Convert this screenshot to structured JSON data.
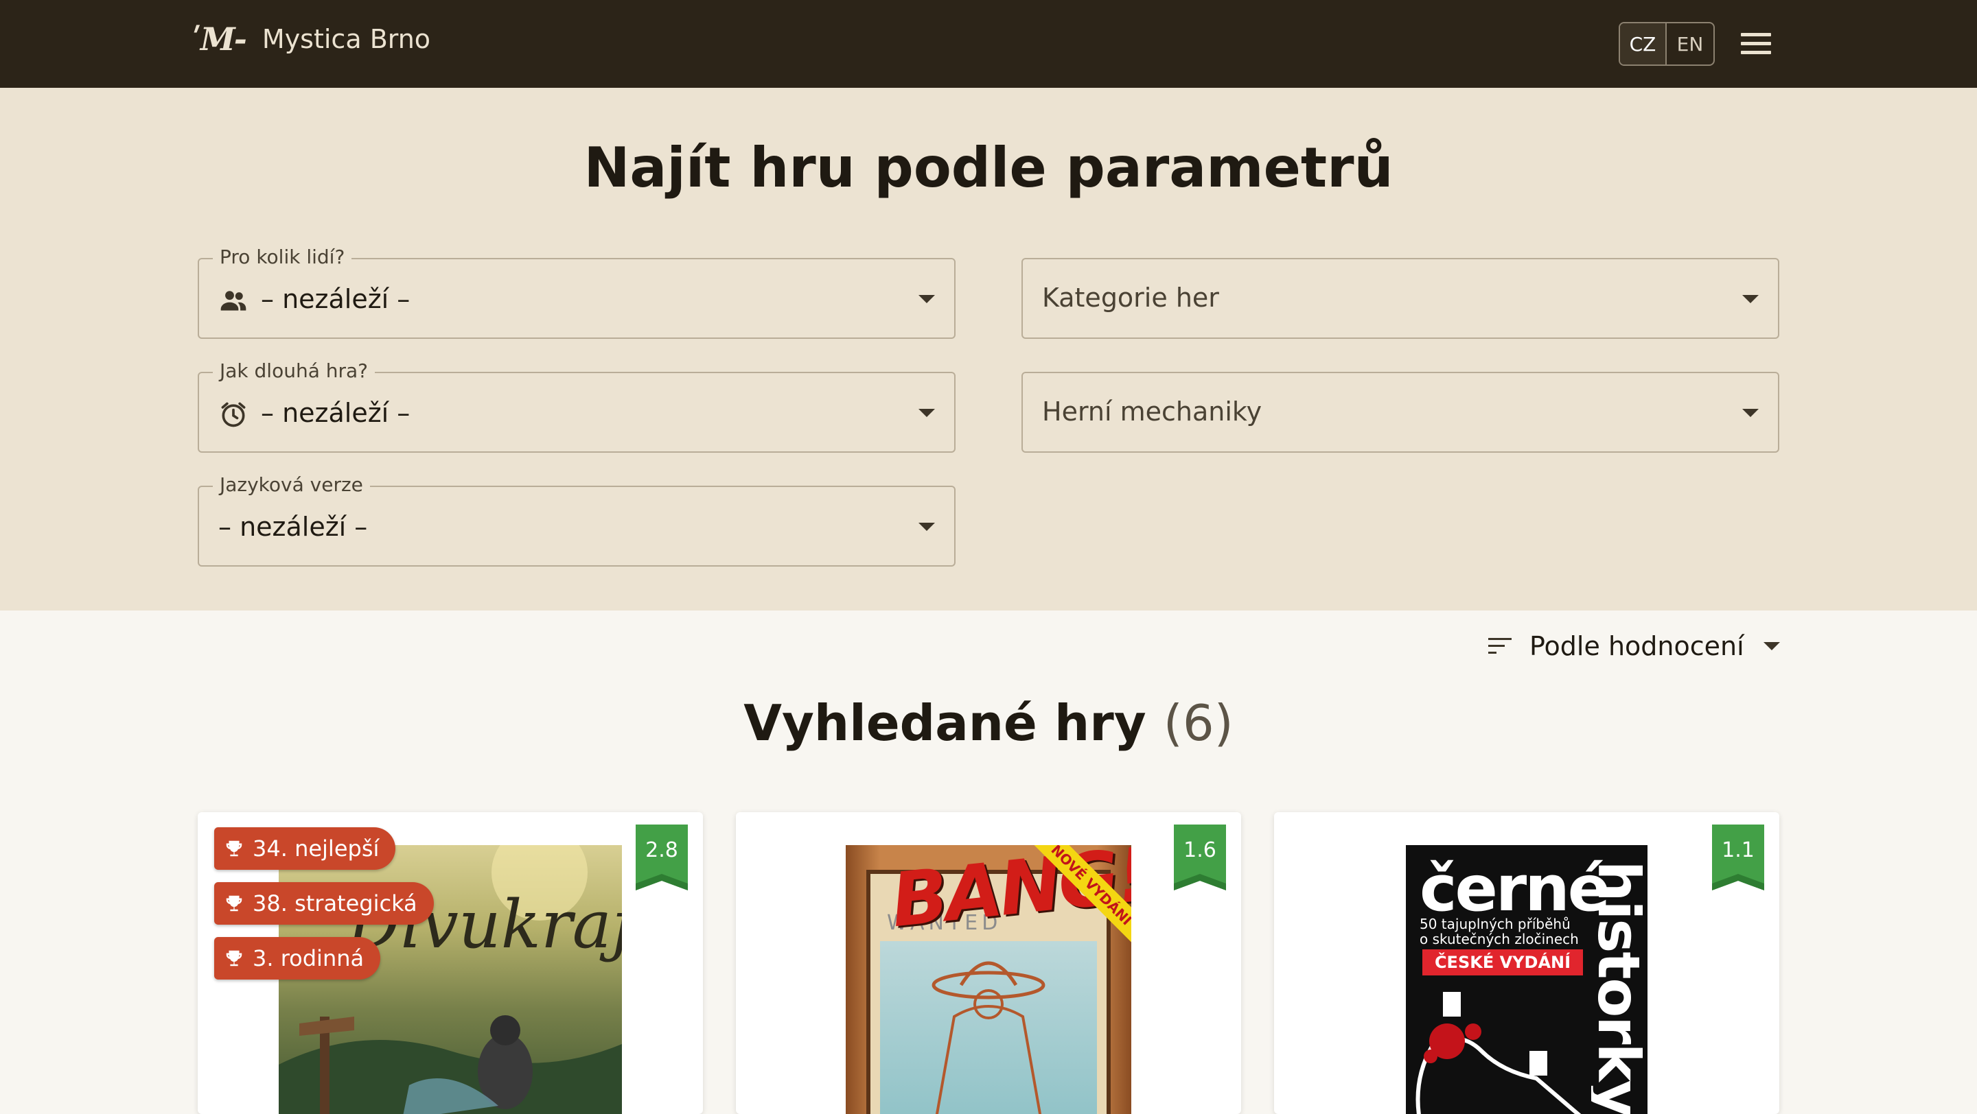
{
  "header": {
    "logo_mark": "ʹM-",
    "brand": "Mystica Brno",
    "languages": [
      {
        "code": "CZ",
        "active": true
      },
      {
        "code": "EN",
        "active": false
      }
    ],
    "menu_icon": "hamburger-menu-icon"
  },
  "filters": {
    "title": "Najít hru podle parametrů",
    "players": {
      "legend": "Pro kolik lidí?",
      "value": "– nezáleží –",
      "icon": "people-icon"
    },
    "duration": {
      "legend": "Jak dlouhá hra?",
      "value": "– nezáleží –",
      "icon": "alarm-clock-icon"
    },
    "language": {
      "legend": "Jazyková verze",
      "value": "– nezáleží –"
    },
    "categories": {
      "placeholder": "Kategorie her"
    },
    "mechanics": {
      "placeholder": "Herní mechaniky"
    }
  },
  "results": {
    "sort_label": "Podle hodnocení",
    "title": "Vyhledané hry",
    "count": "(6)",
    "cards": [
      {
        "rating": "2.8",
        "rating_color": "#43a047",
        "cover_title": "Divukraj",
        "ranks": [
          "34. nejlepší",
          "38. strategická",
          "3. rodinná"
        ]
      },
      {
        "rating": "1.6",
        "rating_color": "#43a047",
        "cover_title": "BANG!",
        "cover_subtitle": "WANTED",
        "cover_badge": "NOVÉ VYDÁNÍ"
      },
      {
        "rating": "1.1",
        "rating_color": "#43a047",
        "cover_title": "černé",
        "cover_side": "historky",
        "cover_line1": "50 tajuplných příběhů",
        "cover_line2": "o skutečných zločinech",
        "cover_badge": "ČESKÉ VYDÁNÍ"
      }
    ]
  },
  "colors": {
    "topbar": "#2c2418",
    "filter_bg": "#ece3d2",
    "page_bg": "#f8f6f1",
    "rank_tag": "#c9472a",
    "rating_ribbon": "#43a047"
  }
}
